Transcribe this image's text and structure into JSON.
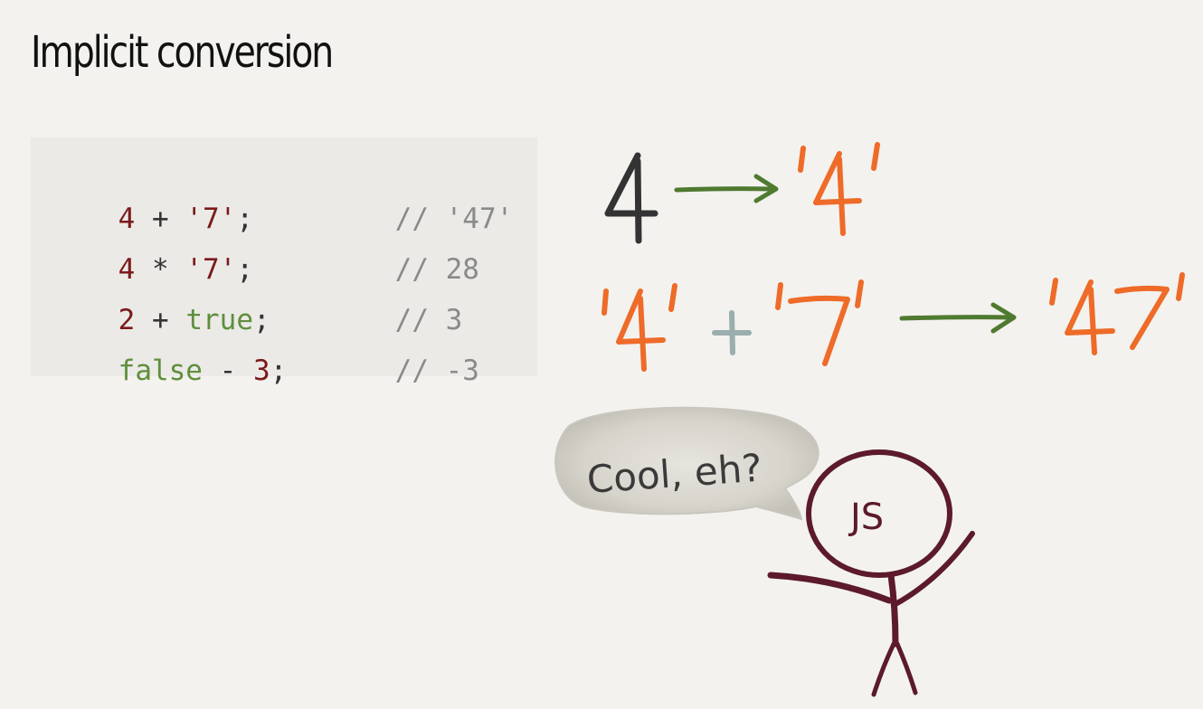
{
  "slide": {
    "title": "Implicit conversion"
  },
  "code": {
    "lines": [
      {
        "tokens": [
          {
            "text": "4",
            "kind": "num"
          },
          {
            "text": " + ",
            "kind": "op"
          },
          {
            "text": "'7'",
            "kind": "str"
          },
          {
            "text": ";",
            "kind": "punct"
          }
        ],
        "comment": "// '47'"
      },
      {
        "tokens": [
          {
            "text": "4",
            "kind": "num"
          },
          {
            "text": " * ",
            "kind": "op"
          },
          {
            "text": "'7'",
            "kind": "str"
          },
          {
            "text": ";",
            "kind": "punct"
          }
        ],
        "comment": "// 28"
      },
      {
        "tokens": [
          {
            "text": "2",
            "kind": "num"
          },
          {
            "text": " + ",
            "kind": "op"
          },
          {
            "text": "true",
            "kind": "bool"
          },
          {
            "text": ";",
            "kind": "punct"
          }
        ],
        "comment": "// 3"
      },
      {
        "tokens": [
          {
            "text": "false",
            "kind": "bool"
          },
          {
            "text": " - ",
            "kind": "op"
          },
          {
            "text": "3",
            "kind": "num"
          },
          {
            "text": ";",
            "kind": "punct"
          }
        ],
        "comment": "// -3"
      }
    ]
  },
  "illustration": {
    "speech_bubble_text": "Cool, eh?",
    "character_label": "JS",
    "drawn_equations": [
      "4 → '4'",
      "'4' + '7' → '47'"
    ]
  },
  "colors": {
    "background": "#f3f2ef",
    "code_background": "#ebeae7",
    "number_red": "#7b1a1a",
    "boolean_green": "#5f8f3c",
    "comment_gray": "#8a8a8a",
    "sketch_orange": "#ee6b28",
    "sketch_arrow_green": "#4f7a2f",
    "sketch_dark": "#333333",
    "sketch_plus": "#9aaeae",
    "character_maroon": "#5c1a2a"
  }
}
